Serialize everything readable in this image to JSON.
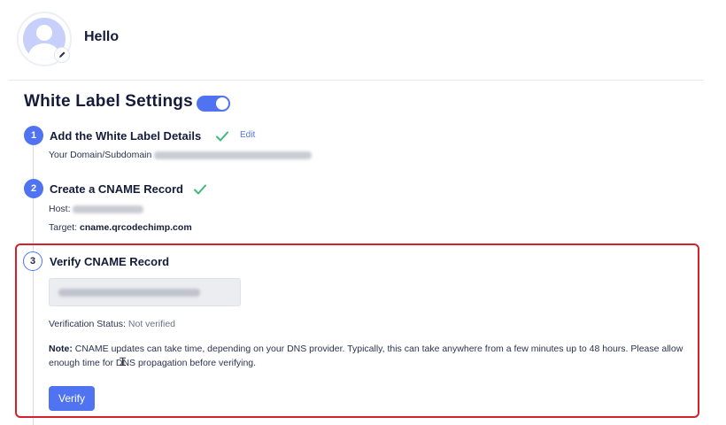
{
  "header": {
    "greeting": "Hello",
    "avatar_icon": "user-avatar-icon",
    "edit_icon": "pencil-icon"
  },
  "settings": {
    "title": "White Label Settings",
    "toggle_on": true
  },
  "steps": [
    {
      "number": "1",
      "title": "Add the White Label Details",
      "completed": true,
      "edit_label": "Edit",
      "details": [
        {
          "label": "Your Domain/Subdomain",
          "value": ""
        }
      ]
    },
    {
      "number": "2",
      "title": "Create a CNAME Record",
      "completed": true,
      "details": [
        {
          "label": "Host:",
          "value": ""
        },
        {
          "label": "Target:",
          "value": "cname.qrcodechimp.com"
        }
      ]
    },
    {
      "number": "3",
      "title": "Verify CNAME Record",
      "completed": false,
      "status_label": "Verification Status:",
      "status_value": "Not verified",
      "note_label": "Note:",
      "note_text": " CNAME updates can take time, depending on your DNS provider. Typically, this can take anywhere from a few minutes up to 48 hours. Please allow enough time for DNS propagation before verifying.",
      "button_label": "Verify"
    }
  ],
  "colors": {
    "accent": "#4f73f1",
    "check": "#3dba7e",
    "highlight_border": "#d81f2a"
  }
}
